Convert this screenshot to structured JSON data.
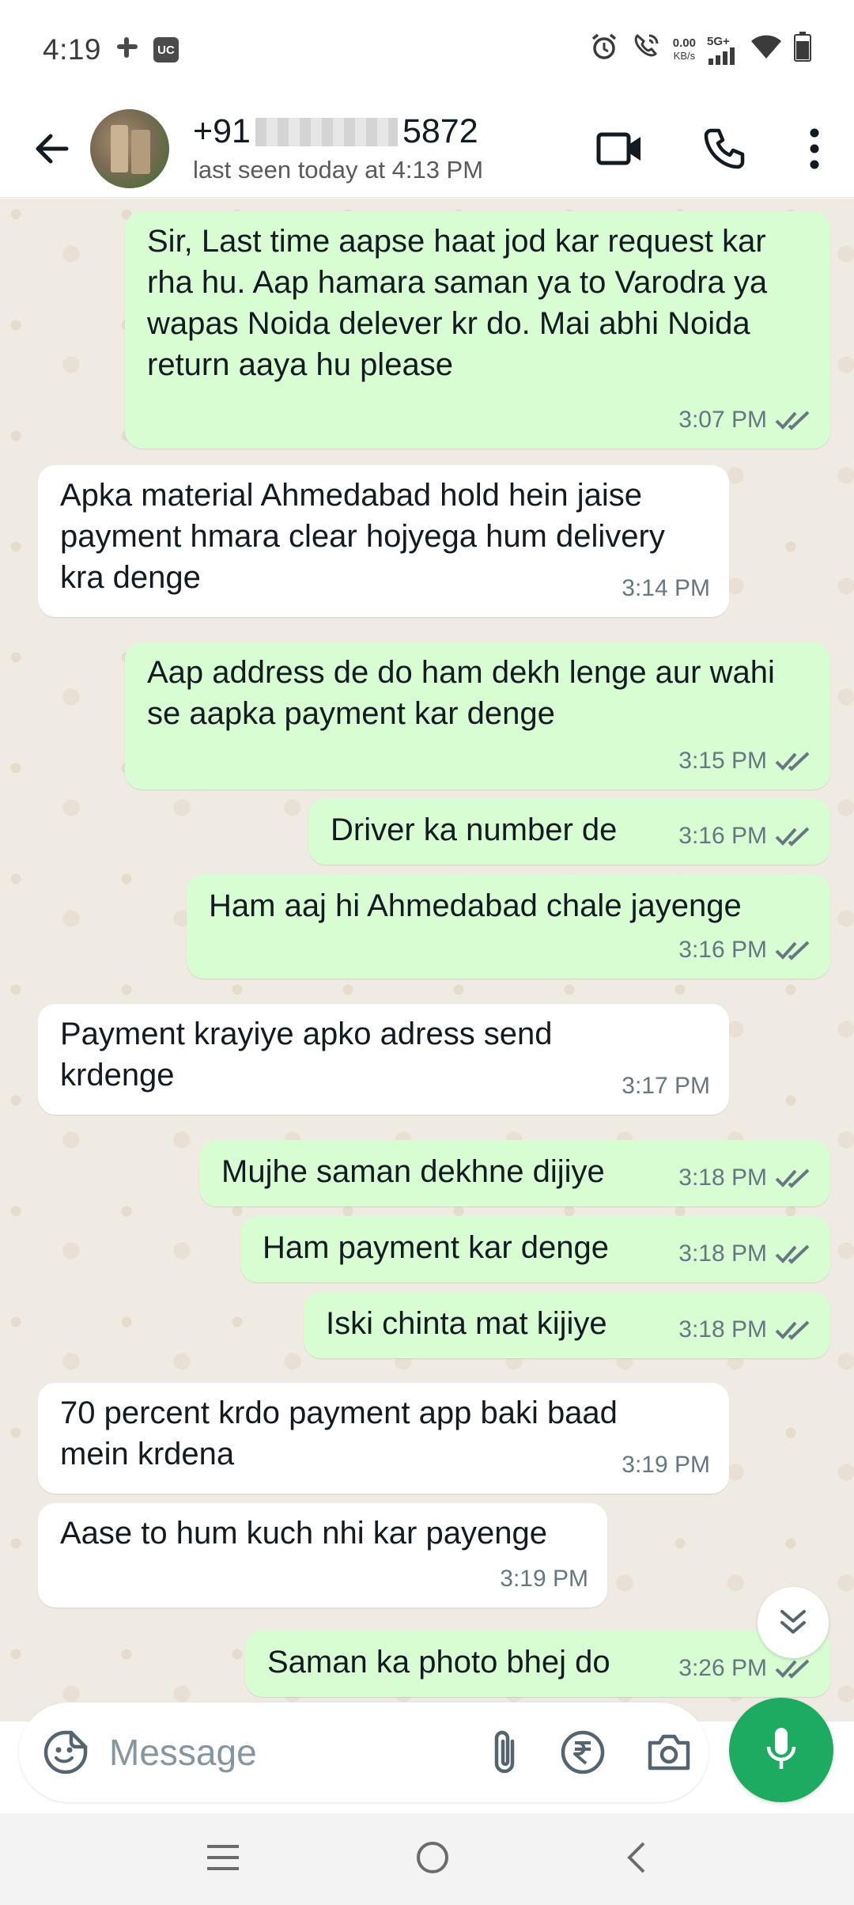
{
  "status_bar": {
    "time": "4:19",
    "uc_label": "UC",
    "data_speed": "0.00",
    "data_unit": "KB/s",
    "network": "5G+"
  },
  "header": {
    "contact_prefix": "+91",
    "contact_suffix": "5872",
    "last_seen": "last seen today at 4:13 PM"
  },
  "messages": [
    {
      "dir": "out",
      "text": "Sir, Last time aapse haat jod kar request kar rha hu. Aap hamara saman ya to Varodra ya wapas Noida delever kr do. Mai abhi Noida return aaya hu please",
      "time": "3:07 PM"
    },
    {
      "dir": "in",
      "text": "Apka material Ahmedabad hold hein jaise payment hmara clear hojyega hum delivery kra denge",
      "time": "3:14 PM"
    },
    {
      "dir": "out",
      "text": "Aap address de do ham dekh lenge aur wahi se aapka payment kar denge",
      "time": "3:15 PM"
    },
    {
      "dir": "out",
      "text": "Driver ka number de",
      "time": "3:16 PM"
    },
    {
      "dir": "out",
      "text": "Ham aaj hi Ahmedabad chale jayenge",
      "time": "3:16 PM"
    },
    {
      "dir": "in",
      "text": "Payment krayiye apko adress send krdenge",
      "time": "3:17 PM"
    },
    {
      "dir": "out",
      "text": "Mujhe saman dekhne dijiye",
      "time": "3:18 PM"
    },
    {
      "dir": "out",
      "text": "Ham payment kar denge",
      "time": "3:18 PM"
    },
    {
      "dir": "out",
      "text": "Iski chinta mat kijiye",
      "time": "3:18 PM"
    },
    {
      "dir": "in",
      "text": "70 percent krdo payment app baki baad mein krdena",
      "time": "3:19 PM"
    },
    {
      "dir": "in",
      "text": "Aase to hum kuch nhi kar payenge",
      "time": "3:19 PM"
    },
    {
      "dir": "out",
      "text": "Saman ka photo bhej do",
      "time": "3:26 PM"
    }
  ],
  "composer": {
    "placeholder": "Message"
  },
  "colors": {
    "outgoing_bubble": "#d9fdd3",
    "incoming_bubble": "#ffffff",
    "chat_bg": "#efeae2",
    "accent_green": "#1daa61",
    "read_tick": "#667781"
  },
  "icons": {
    "back": "arrow-left-icon",
    "video": "video-camera-icon",
    "call": "phone-icon",
    "menu": "more-vertical-icon",
    "emoji": "sticker-icon",
    "attach": "paperclip-icon",
    "payment": "rupee-icon",
    "camera": "camera-icon",
    "mic": "microphone-icon",
    "scroll_down": "double-chevron-down-icon"
  }
}
